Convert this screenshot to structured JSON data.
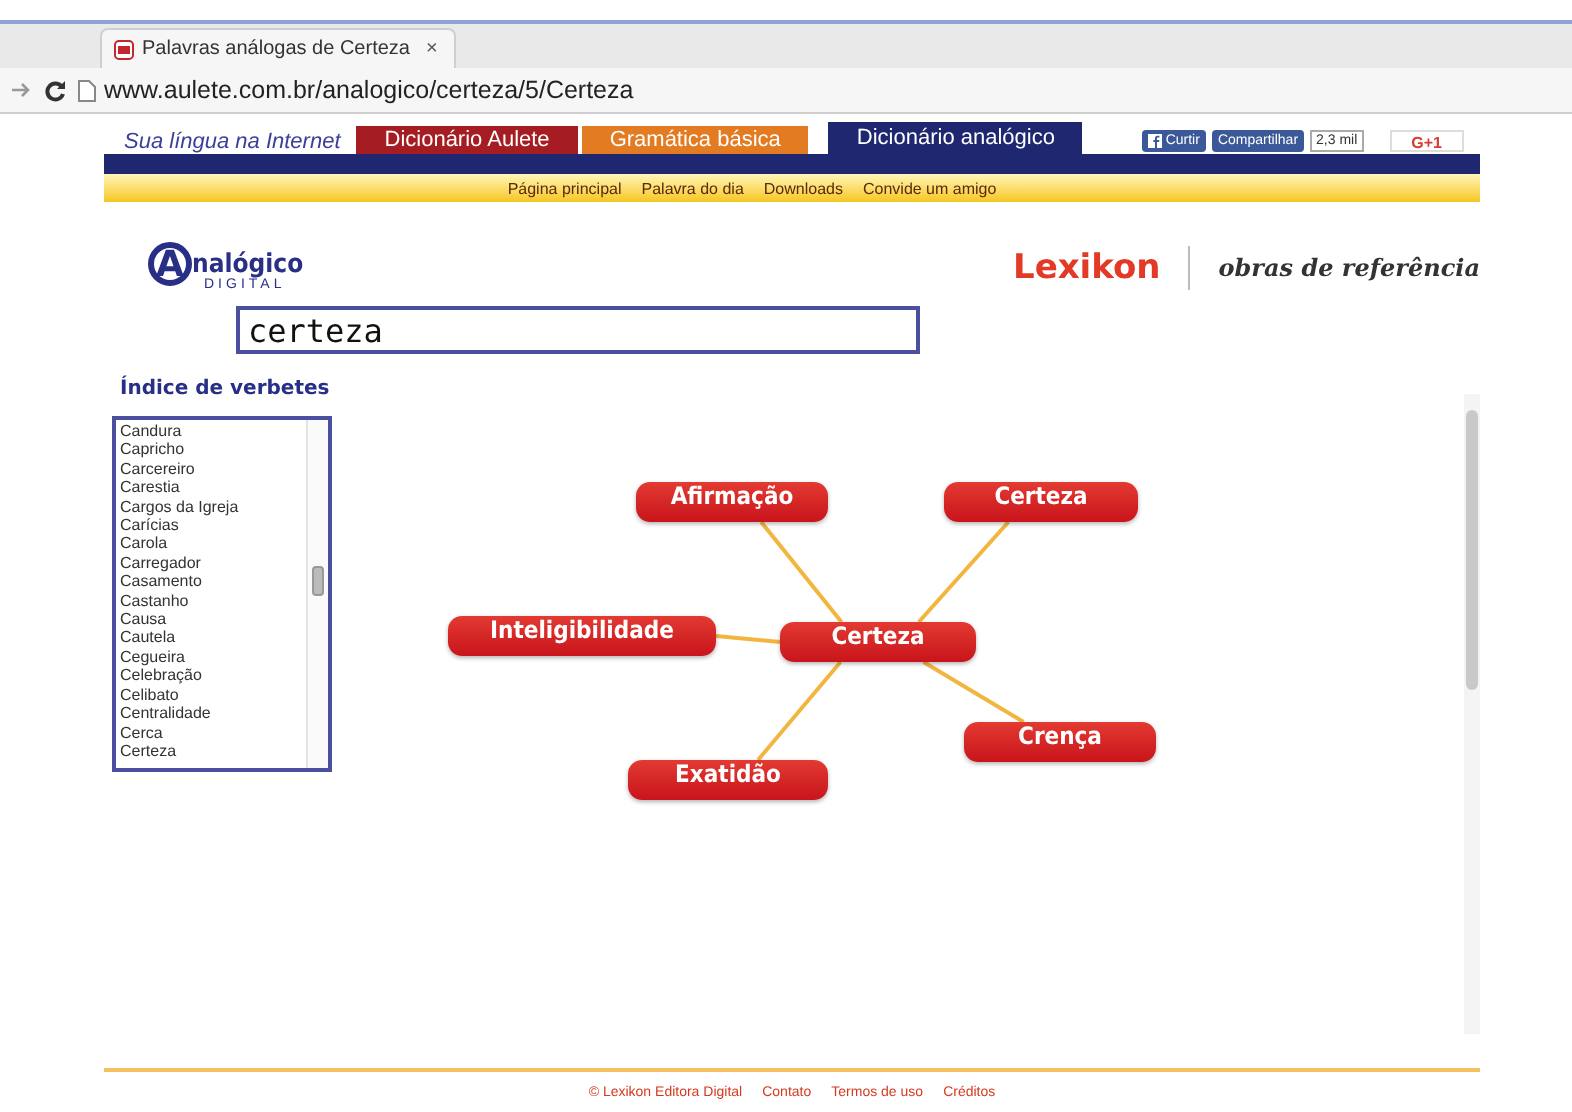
{
  "browser": {
    "tab_title": "Palavras análogas de Certeza",
    "tab_close": "×",
    "url": "www.aulete.com.br/analogico/certeza/5/Certeza"
  },
  "site_nav": {
    "tagline": "Sua língua na Internet",
    "tabs": [
      {
        "label": "Dicionário Aulete",
        "color": "#a51d22",
        "selected": false
      },
      {
        "label": "Gramática básica",
        "color": "#e27b22",
        "selected": false
      },
      {
        "label": "Dicionário analógico",
        "color": "#1f2770",
        "selected": true
      }
    ],
    "social": {
      "like": "Curtir",
      "share": "Compartilhar",
      "count": "2,3 mil",
      "gplus": "G+1"
    },
    "links": [
      "Página principal",
      "Palavra do dia",
      "Downloads",
      "Convide um amigo"
    ]
  },
  "logo": {
    "initial": "A",
    "rest": "nalógico",
    "sub": "DIGITAL"
  },
  "brand": {
    "name": "Lexikon",
    "tagline": "obras de referência"
  },
  "search": {
    "value": "certeza"
  },
  "index": {
    "title": "Índice de verbetes",
    "items": [
      "Candura",
      "Capricho",
      "Carcereiro",
      "Carestia",
      "Cargos da Igreja",
      "Carícias",
      "Carola",
      "Carregador",
      "Casamento",
      "Castanho",
      "Causa",
      "Cautela",
      "Cegueira",
      "Celebração",
      "Celibato",
      "Centralidade",
      "Cerca",
      "Certeza"
    ]
  },
  "map": {
    "center": "Certeza",
    "nodes": [
      {
        "label": "Afirmação"
      },
      {
        "label": "Certeza"
      },
      {
        "label": "Inteligibilidade"
      },
      {
        "label": "Crença"
      },
      {
        "label": "Exatidão"
      }
    ]
  },
  "footer": {
    "links": [
      "© Lexikon Editora Digital",
      "Contato",
      "Termos de uso",
      "Créditos"
    ]
  }
}
